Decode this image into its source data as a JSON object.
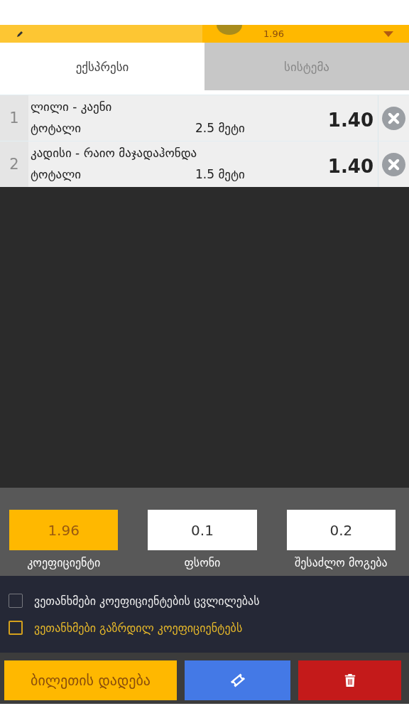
{
  "top_bar": {
    "odds": "1.96"
  },
  "tabs": [
    {
      "label": "ექსპრესი",
      "selected": true
    },
    {
      "label": "სისტემა",
      "selected": false
    }
  ],
  "bets": [
    {
      "number": "1",
      "match": "ლილი - კაენი",
      "market": "ტოტალი",
      "pick": "2.5 მეტი",
      "odds": "1.40"
    },
    {
      "number": "2",
      "match": "კადისი - რაიო მაჯადაჰონდა",
      "market": "ტოტალი",
      "pick": "1.5 მეტი",
      "odds": "1.40"
    }
  ],
  "summary": [
    {
      "kind": "odds",
      "value": "1.96",
      "label": "კოეფიციენტი"
    },
    {
      "kind": "stake",
      "value": "0.1",
      "label": "ფსონი"
    },
    {
      "kind": "win",
      "value": "0.2",
      "label": "შესაძლო მოგება"
    }
  ],
  "options": [
    {
      "label": "ვეთანხმები კოეფიციენტების ცვლილებას",
      "checked": false,
      "highlighted": false
    },
    {
      "label": "ვეთანხმები გაზრდილ კოეფიციენტებს",
      "checked": false,
      "highlighted": true
    }
  ],
  "place_bet_button": "ბილეთის დადება"
}
